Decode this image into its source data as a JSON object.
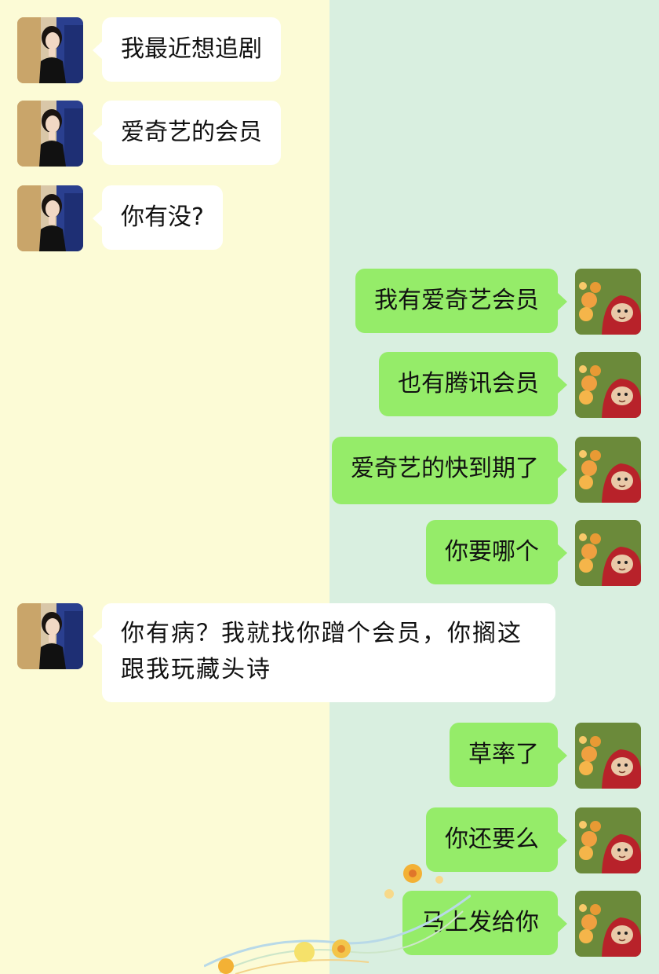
{
  "messages": [
    {
      "side": "left",
      "text": "我最近想追剧"
    },
    {
      "side": "left",
      "text": "爱奇艺的会员"
    },
    {
      "side": "left",
      "text": "你有没?"
    },
    {
      "side": "right",
      "text": "我有爱奇艺会员"
    },
    {
      "side": "right",
      "text": "也有腾讯会员"
    },
    {
      "side": "right",
      "text": "爱奇艺的快到期了"
    },
    {
      "side": "right",
      "text": "你要哪个"
    },
    {
      "side": "left",
      "text": "你有病？我就找你蹭个会员，你搁这跟我玩藏头诗"
    },
    {
      "side": "right",
      "text": "草率了"
    },
    {
      "side": "right",
      "text": "你还要么"
    },
    {
      "side": "right",
      "text": "马上发给你"
    }
  ],
  "colors": {
    "left_background": "#fcfbd6",
    "right_background": "#d9efe0",
    "left_bubble": "#ffffff",
    "right_bubble": "#95ec69"
  },
  "icons": {
    "left_avatar": "girl-photo-avatar",
    "right_avatar": "red-teletubby-avatar"
  }
}
